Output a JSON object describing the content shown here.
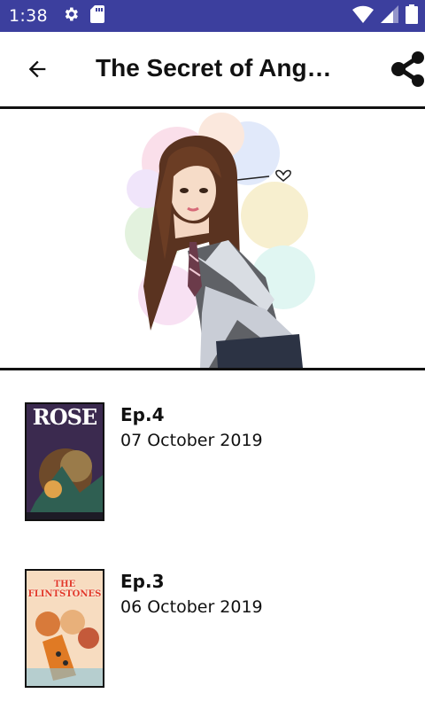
{
  "status_bar": {
    "time": "1:38",
    "icons": [
      "gear-icon",
      "sd-card-icon",
      "wifi-icon",
      "signal-icon",
      "battery-icon"
    ],
    "color": "#3c3f9e"
  },
  "app_bar": {
    "title": "The Secret of Ang…",
    "back_icon": "arrow-left-icon",
    "share_icon": "share-icon"
  },
  "hero": {
    "image": "illustration-girl-in-school-uniform"
  },
  "episodes": [
    {
      "title": "Ep.4",
      "date": "07 October 2019",
      "cover_title": "ROSE"
    },
    {
      "title": "Ep.3",
      "date": "06 October 2019",
      "cover_title": "THE FLINTSTONES"
    }
  ]
}
